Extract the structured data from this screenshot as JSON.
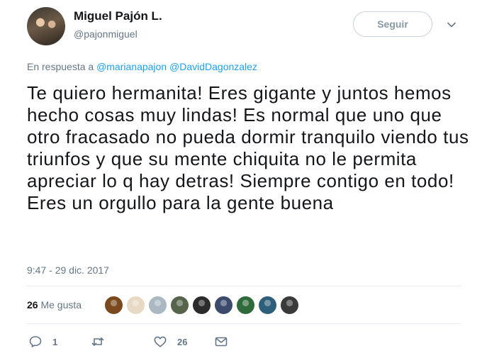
{
  "header": {
    "display_name": "Miguel Pajón L.",
    "handle": "@pajonmiguel",
    "follow_label": "Seguir"
  },
  "reply": {
    "prefix": "En respuesta a",
    "mentions": [
      "@marianapajon",
      "@DavidDagonzalez"
    ]
  },
  "tweet": {
    "text": "Te quiero hermanita! Eres gigante y juntos hemos hecho cosas muy lindas! Es normal que uno que otro fracasado no pueda dormir tranquilo viendo tus triunfos y que su mente chiquita no le permita apreciar lo q hay detras! Siempre contigo en todo! Eres un orgullo para la gente buena",
    "timestamp": "9:47 - 29 dic. 2017"
  },
  "likes": {
    "count": "26",
    "label": "Me gusta",
    "avatar_colors": [
      "#7a4a1e",
      "#e8d9c4",
      "#aab8c2",
      "#55644a",
      "#2b2b2b",
      "#3c4b6b",
      "#2f6b3a",
      "#2d5f7a",
      "#3a3a3a"
    ]
  },
  "actions": {
    "reply_count": "1",
    "like_count": "26"
  },
  "colors": {
    "link": "#1da1f2",
    "muted": "#657786",
    "divider": "#e6ecf0"
  }
}
